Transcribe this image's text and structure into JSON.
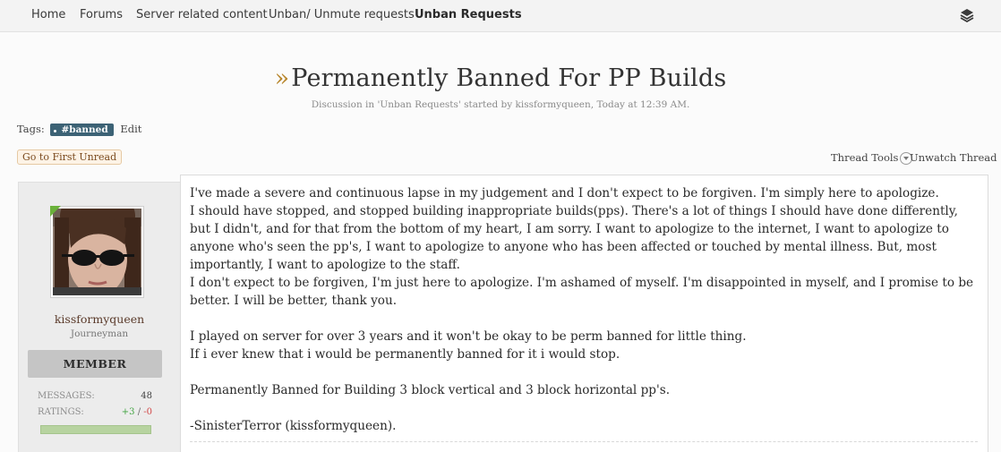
{
  "nav": {
    "items": [
      "Home",
      "Forums",
      "Server related content",
      "Unban/ Unmute requests",
      "Unban Requests"
    ],
    "menu_icon": "layers-icon"
  },
  "thread": {
    "title_prefix": "»",
    "title": "Permanently Banned For PP Builds",
    "subtitle": "Discussion in 'Unban Requests' started by kissformyqueen, Today at 12:39 AM.",
    "tags_label": "Tags:",
    "tag": "#banned",
    "tag_edit": "Edit",
    "first_unread": "Go to First Unread",
    "thread_tools": "Thread Tools",
    "unwatch": "Unwatch Thread"
  },
  "user": {
    "name": "kissformyqueen",
    "title": "Journeyman",
    "banner": "MEMBER",
    "messages_label": "MESSAGES:",
    "messages_value": "48",
    "ratings_label": "RATINGS:",
    "ratings_pos": "+3",
    "ratings_sep": "/",
    "ratings_neg": "-0",
    "online_color": "#6ab13a"
  },
  "post": {
    "paragraphs": [
      "I've made a severe and continuous lapse in my judgement and I don't expect to be forgiven. I'm simply here to apologize.",
      "I should have stopped, and stopped building inappropriate builds(pps). There's a lot of things I should have done differently, but I didn't, and for that from the bottom of my heart, I am sorry. I want to apologize to the internet, I want to apologize to anyone who's seen the pp's, I want to apologize to anyone who has been affected or touched by mental illness. But, most importantly, I want to apologize to the staff.",
      "I don't expect to be forgiven, I'm just here to apologize. I'm ashamed of myself. I'm disappointed in myself, and I promise to be better. I will be better, thank you.",
      "",
      "I played on server for over 3 years and it won't be okay to be perm banned for little thing.",
      "If i ever knew that i would be permanently banned for it i would stop.",
      "",
      "Permanently Banned for Building 3 block vertical and 3 block horizontal pp's.",
      "",
      "-SinisterTerror (kissformyqueen)."
    ]
  }
}
